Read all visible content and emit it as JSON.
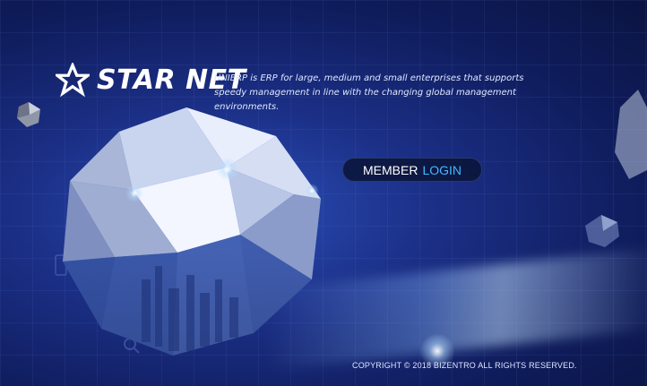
{
  "brand": {
    "name": "STAR NET",
    "tagline": "UNIERP is ERP for large, medium and small enterprises that supports speedy management in line with the changing global management environments."
  },
  "login": {
    "member_label": "MEMBER",
    "login_label": "LOGIN"
  },
  "footer": {
    "copyright": "COPYRIGHT © 2018 BIZENTRO ALL RIGHTS RESERVED."
  },
  "colors": {
    "background": "#1b2f86",
    "accent": "#43b9ff",
    "button_bg": "#0a1437",
    "text": "#ffffff"
  },
  "icons": [
    "star-logo-icon",
    "crystal-gem-graphic",
    "search-icon",
    "phone-icon"
  ]
}
